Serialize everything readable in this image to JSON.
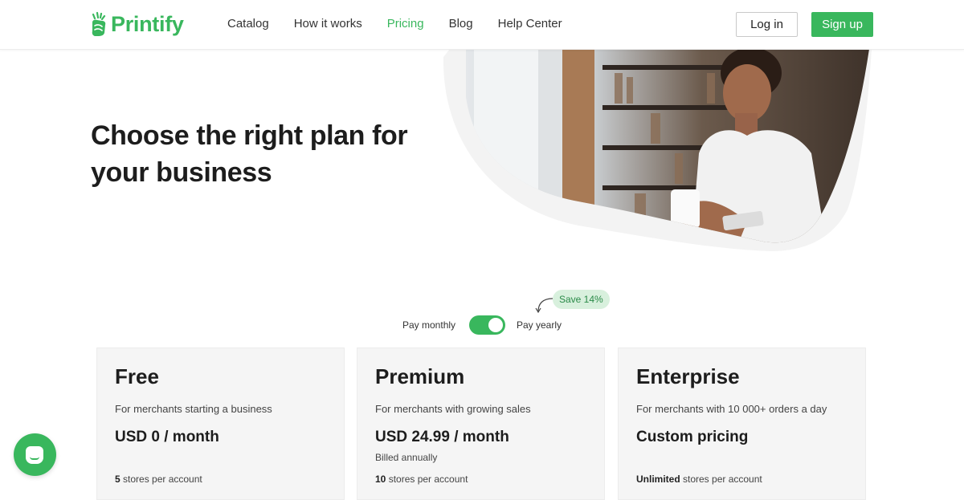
{
  "brand": {
    "name": "Printify",
    "color": "#39b75d",
    "logo_icon": "printify-hand-icon"
  },
  "nav": {
    "items": [
      {
        "label": "Catalog",
        "active": false
      },
      {
        "label": "How it works",
        "active": false
      },
      {
        "label": "Pricing",
        "active": true
      },
      {
        "label": "Blog",
        "active": false
      },
      {
        "label": "Help Center",
        "active": false
      }
    ]
  },
  "auth": {
    "login_label": "Log in",
    "signup_label": "Sign up"
  },
  "hero": {
    "title_line1": "Choose the right plan for",
    "title_line2": "your business",
    "image": "woman-with-coffee-and-phone-photo"
  },
  "billing": {
    "monthly_label": "Pay monthly",
    "yearly_label": "Pay yearly",
    "save_badge": "Save 14%",
    "yearly_selected": true
  },
  "plans": [
    {
      "name": "Free",
      "description": "For merchants starting a business",
      "price": "USD 0 / month",
      "billing_note": "",
      "stores_count": "5",
      "stores_suffix": " stores per account"
    },
    {
      "name": "Premium",
      "description": "For merchants with growing sales",
      "price": "USD 24.99 / month",
      "billing_note": "Billed annually",
      "stores_count": "10",
      "stores_suffix": " stores per account"
    },
    {
      "name": "Enterprise",
      "description": "For merchants with 10 000+ orders a day",
      "price": "Custom pricing",
      "billing_note": "",
      "stores_count": "Unlimited",
      "stores_suffix": " stores per account"
    }
  ],
  "chat": {
    "icon": "chat-icon"
  }
}
